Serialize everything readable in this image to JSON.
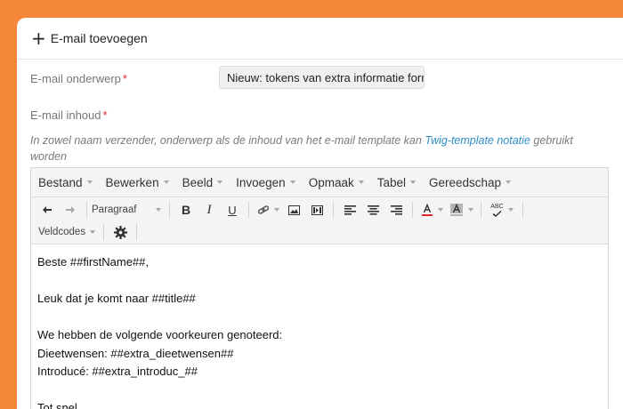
{
  "panel": {
    "title": "E-mail toevoegen"
  },
  "form": {
    "subject_label": "E-mail onderwerp",
    "subject_value": "Nieuw: tokens van extra informatie formulier",
    "content_label": "E-mail inhoud",
    "required_mark": "*",
    "help_prefix": "In zowel naam verzender, onderwerp als de inhoud van het e-mail template kan ",
    "help_link": "Twig-template notatie",
    "help_suffix": " gebruikt worden"
  },
  "editor": {
    "menus": [
      "Bestand",
      "Bewerken",
      "Beeld",
      "Invoegen",
      "Opmaak",
      "Tabel",
      "Gereedschap"
    ],
    "format_select": "Paragraaf",
    "fieldcodes_label": "Veldcodes",
    "bold_label": "B",
    "italic_label": "I",
    "underline_label": "U",
    "spellcheck_label": "ABC",
    "lines": [
      "Beste ##firstName##,",
      "",
      "Leuk dat je komt naar ##title##",
      "",
      "We hebben de volgende voorkeuren genoteerd:",
      "Dieetwensen: ##extra_dieetwensen##",
      "Introducé: ##extra_introduc_##",
      "",
      "Tot snel"
    ]
  },
  "colors": {
    "background": "#f5873a",
    "link": "#2f8ec7",
    "required": "#e0262c"
  }
}
